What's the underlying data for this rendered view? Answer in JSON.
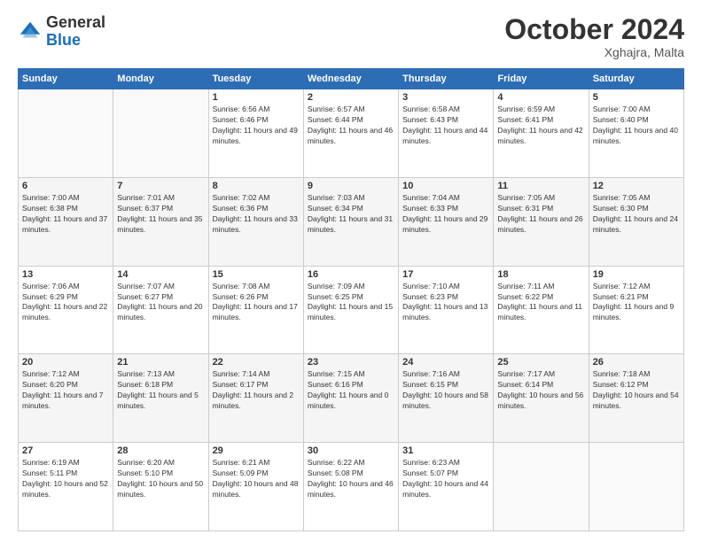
{
  "header": {
    "logo_general": "General",
    "logo_blue": "Blue",
    "month_title": "October 2024",
    "location": "Xghajra, Malta"
  },
  "days_of_week": [
    "Sunday",
    "Monday",
    "Tuesday",
    "Wednesday",
    "Thursday",
    "Friday",
    "Saturday"
  ],
  "weeks": [
    [
      {
        "day": "",
        "info": ""
      },
      {
        "day": "",
        "info": ""
      },
      {
        "day": "1",
        "info": "Sunrise: 6:56 AM\nSunset: 6:46 PM\nDaylight: 11 hours and 49 minutes."
      },
      {
        "day": "2",
        "info": "Sunrise: 6:57 AM\nSunset: 6:44 PM\nDaylight: 11 hours and 46 minutes."
      },
      {
        "day": "3",
        "info": "Sunrise: 6:58 AM\nSunset: 6:43 PM\nDaylight: 11 hours and 44 minutes."
      },
      {
        "day": "4",
        "info": "Sunrise: 6:59 AM\nSunset: 6:41 PM\nDaylight: 11 hours and 42 minutes."
      },
      {
        "day": "5",
        "info": "Sunrise: 7:00 AM\nSunset: 6:40 PM\nDaylight: 11 hours and 40 minutes."
      }
    ],
    [
      {
        "day": "6",
        "info": "Sunrise: 7:00 AM\nSunset: 6:38 PM\nDaylight: 11 hours and 37 minutes."
      },
      {
        "day": "7",
        "info": "Sunrise: 7:01 AM\nSunset: 6:37 PM\nDaylight: 11 hours and 35 minutes."
      },
      {
        "day": "8",
        "info": "Sunrise: 7:02 AM\nSunset: 6:36 PM\nDaylight: 11 hours and 33 minutes."
      },
      {
        "day": "9",
        "info": "Sunrise: 7:03 AM\nSunset: 6:34 PM\nDaylight: 11 hours and 31 minutes."
      },
      {
        "day": "10",
        "info": "Sunrise: 7:04 AM\nSunset: 6:33 PM\nDaylight: 11 hours and 29 minutes."
      },
      {
        "day": "11",
        "info": "Sunrise: 7:05 AM\nSunset: 6:31 PM\nDaylight: 11 hours and 26 minutes."
      },
      {
        "day": "12",
        "info": "Sunrise: 7:05 AM\nSunset: 6:30 PM\nDaylight: 11 hours and 24 minutes."
      }
    ],
    [
      {
        "day": "13",
        "info": "Sunrise: 7:06 AM\nSunset: 6:29 PM\nDaylight: 11 hours and 22 minutes."
      },
      {
        "day": "14",
        "info": "Sunrise: 7:07 AM\nSunset: 6:27 PM\nDaylight: 11 hours and 20 minutes."
      },
      {
        "day": "15",
        "info": "Sunrise: 7:08 AM\nSunset: 6:26 PM\nDaylight: 11 hours and 17 minutes."
      },
      {
        "day": "16",
        "info": "Sunrise: 7:09 AM\nSunset: 6:25 PM\nDaylight: 11 hours and 15 minutes."
      },
      {
        "day": "17",
        "info": "Sunrise: 7:10 AM\nSunset: 6:23 PM\nDaylight: 11 hours and 13 minutes."
      },
      {
        "day": "18",
        "info": "Sunrise: 7:11 AM\nSunset: 6:22 PM\nDaylight: 11 hours and 11 minutes."
      },
      {
        "day": "19",
        "info": "Sunrise: 7:12 AM\nSunset: 6:21 PM\nDaylight: 11 hours and 9 minutes."
      }
    ],
    [
      {
        "day": "20",
        "info": "Sunrise: 7:12 AM\nSunset: 6:20 PM\nDaylight: 11 hours and 7 minutes."
      },
      {
        "day": "21",
        "info": "Sunrise: 7:13 AM\nSunset: 6:18 PM\nDaylight: 11 hours and 5 minutes."
      },
      {
        "day": "22",
        "info": "Sunrise: 7:14 AM\nSunset: 6:17 PM\nDaylight: 11 hours and 2 minutes."
      },
      {
        "day": "23",
        "info": "Sunrise: 7:15 AM\nSunset: 6:16 PM\nDaylight: 11 hours and 0 minutes."
      },
      {
        "day": "24",
        "info": "Sunrise: 7:16 AM\nSunset: 6:15 PM\nDaylight: 10 hours and 58 minutes."
      },
      {
        "day": "25",
        "info": "Sunrise: 7:17 AM\nSunset: 6:14 PM\nDaylight: 10 hours and 56 minutes."
      },
      {
        "day": "26",
        "info": "Sunrise: 7:18 AM\nSunset: 6:12 PM\nDaylight: 10 hours and 54 minutes."
      }
    ],
    [
      {
        "day": "27",
        "info": "Sunrise: 6:19 AM\nSunset: 5:11 PM\nDaylight: 10 hours and 52 minutes."
      },
      {
        "day": "28",
        "info": "Sunrise: 6:20 AM\nSunset: 5:10 PM\nDaylight: 10 hours and 50 minutes."
      },
      {
        "day": "29",
        "info": "Sunrise: 6:21 AM\nSunset: 5:09 PM\nDaylight: 10 hours and 48 minutes."
      },
      {
        "day": "30",
        "info": "Sunrise: 6:22 AM\nSunset: 5:08 PM\nDaylight: 10 hours and 46 minutes."
      },
      {
        "day": "31",
        "info": "Sunrise: 6:23 AM\nSunset: 5:07 PM\nDaylight: 10 hours and 44 minutes."
      },
      {
        "day": "",
        "info": ""
      },
      {
        "day": "",
        "info": ""
      }
    ]
  ]
}
